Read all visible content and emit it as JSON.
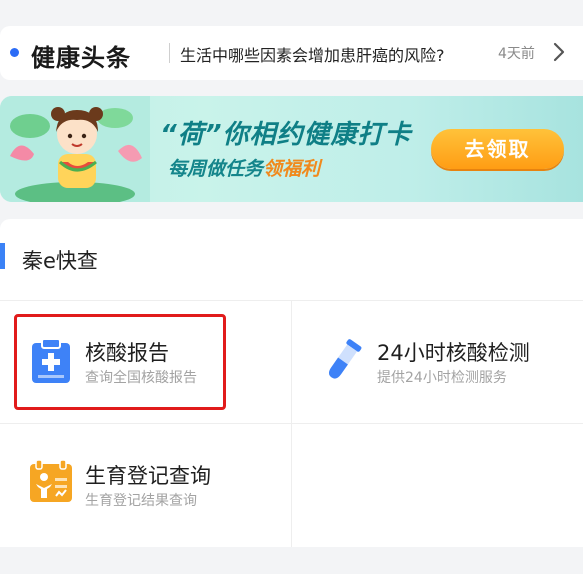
{
  "news": {
    "title": "健康头条",
    "headline": "生活中哪些因素会增加患肝癌的风险?",
    "time": "4天前"
  },
  "banner": {
    "headline": "“荷”你相约健康打卡",
    "sub_prefix": "每周做任务",
    "sub_highlight": "领福利",
    "cta_label": "去领取"
  },
  "quick": {
    "title": "秦e快查",
    "tiles": [
      {
        "title": "核酸报告",
        "subtitle": "查询全国核酸报告",
        "icon": "clipboard-plus-icon",
        "color": "#3e82f7"
      },
      {
        "title": "24小时核酸检测",
        "subtitle": "提供24小时检测服务",
        "icon": "test-tube-icon",
        "color": "#3e82f7"
      },
      {
        "title": "生育登记查询",
        "subtitle": "生育登记结果查询",
        "icon": "birth-registration-icon",
        "color": "#f6a623"
      }
    ]
  },
  "colors": {
    "accent": "#3e82f7",
    "highlight_border": "#e11b1b",
    "cta": "#ff9d14"
  }
}
